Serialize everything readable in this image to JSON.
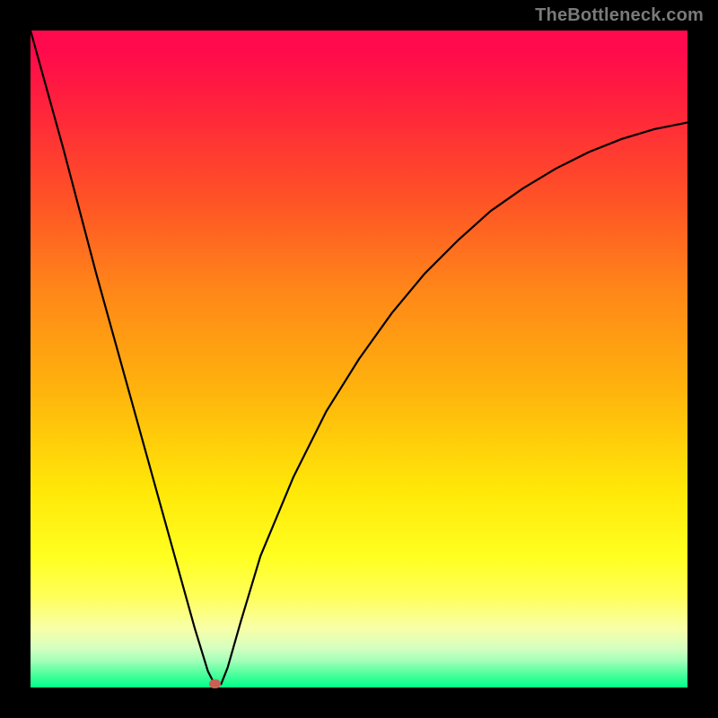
{
  "watermark": "TheBottleneck.com",
  "chart_data": {
    "type": "line",
    "title": "",
    "xlabel": "",
    "ylabel": "",
    "xlim": [
      0,
      100
    ],
    "ylim": [
      0,
      100
    ],
    "grid": false,
    "legend": false,
    "series": [
      {
        "name": "bottleneck-curve",
        "x": [
          0,
          5,
          10,
          15,
          20,
          25,
          27,
          28,
          29,
          30,
          32,
          35,
          40,
          45,
          50,
          55,
          60,
          65,
          70,
          75,
          80,
          85,
          90,
          95,
          100
        ],
        "values": [
          100,
          82,
          63,
          45,
          27,
          9,
          2.5,
          0.5,
          0.5,
          3,
          10,
          20,
          32,
          42,
          50,
          57,
          63,
          68,
          72.5,
          76,
          79,
          81.5,
          83.5,
          85,
          86
        ]
      }
    ],
    "annotations": [
      {
        "name": "minimum-marker",
        "x": 28,
        "y": 0.5
      }
    ],
    "background_gradient": {
      "direction": "top-to-bottom",
      "stops": [
        {
          "pos": 0.0,
          "color": "#ff0a4c"
        },
        {
          "pos": 0.25,
          "color": "#ff5027"
        },
        {
          "pos": 0.55,
          "color": "#ffb40c"
        },
        {
          "pos": 0.8,
          "color": "#ffff20"
        },
        {
          "pos": 0.94,
          "color": "#d5ffc0"
        },
        {
          "pos": 1.0,
          "color": "#00ff88"
        }
      ]
    }
  }
}
